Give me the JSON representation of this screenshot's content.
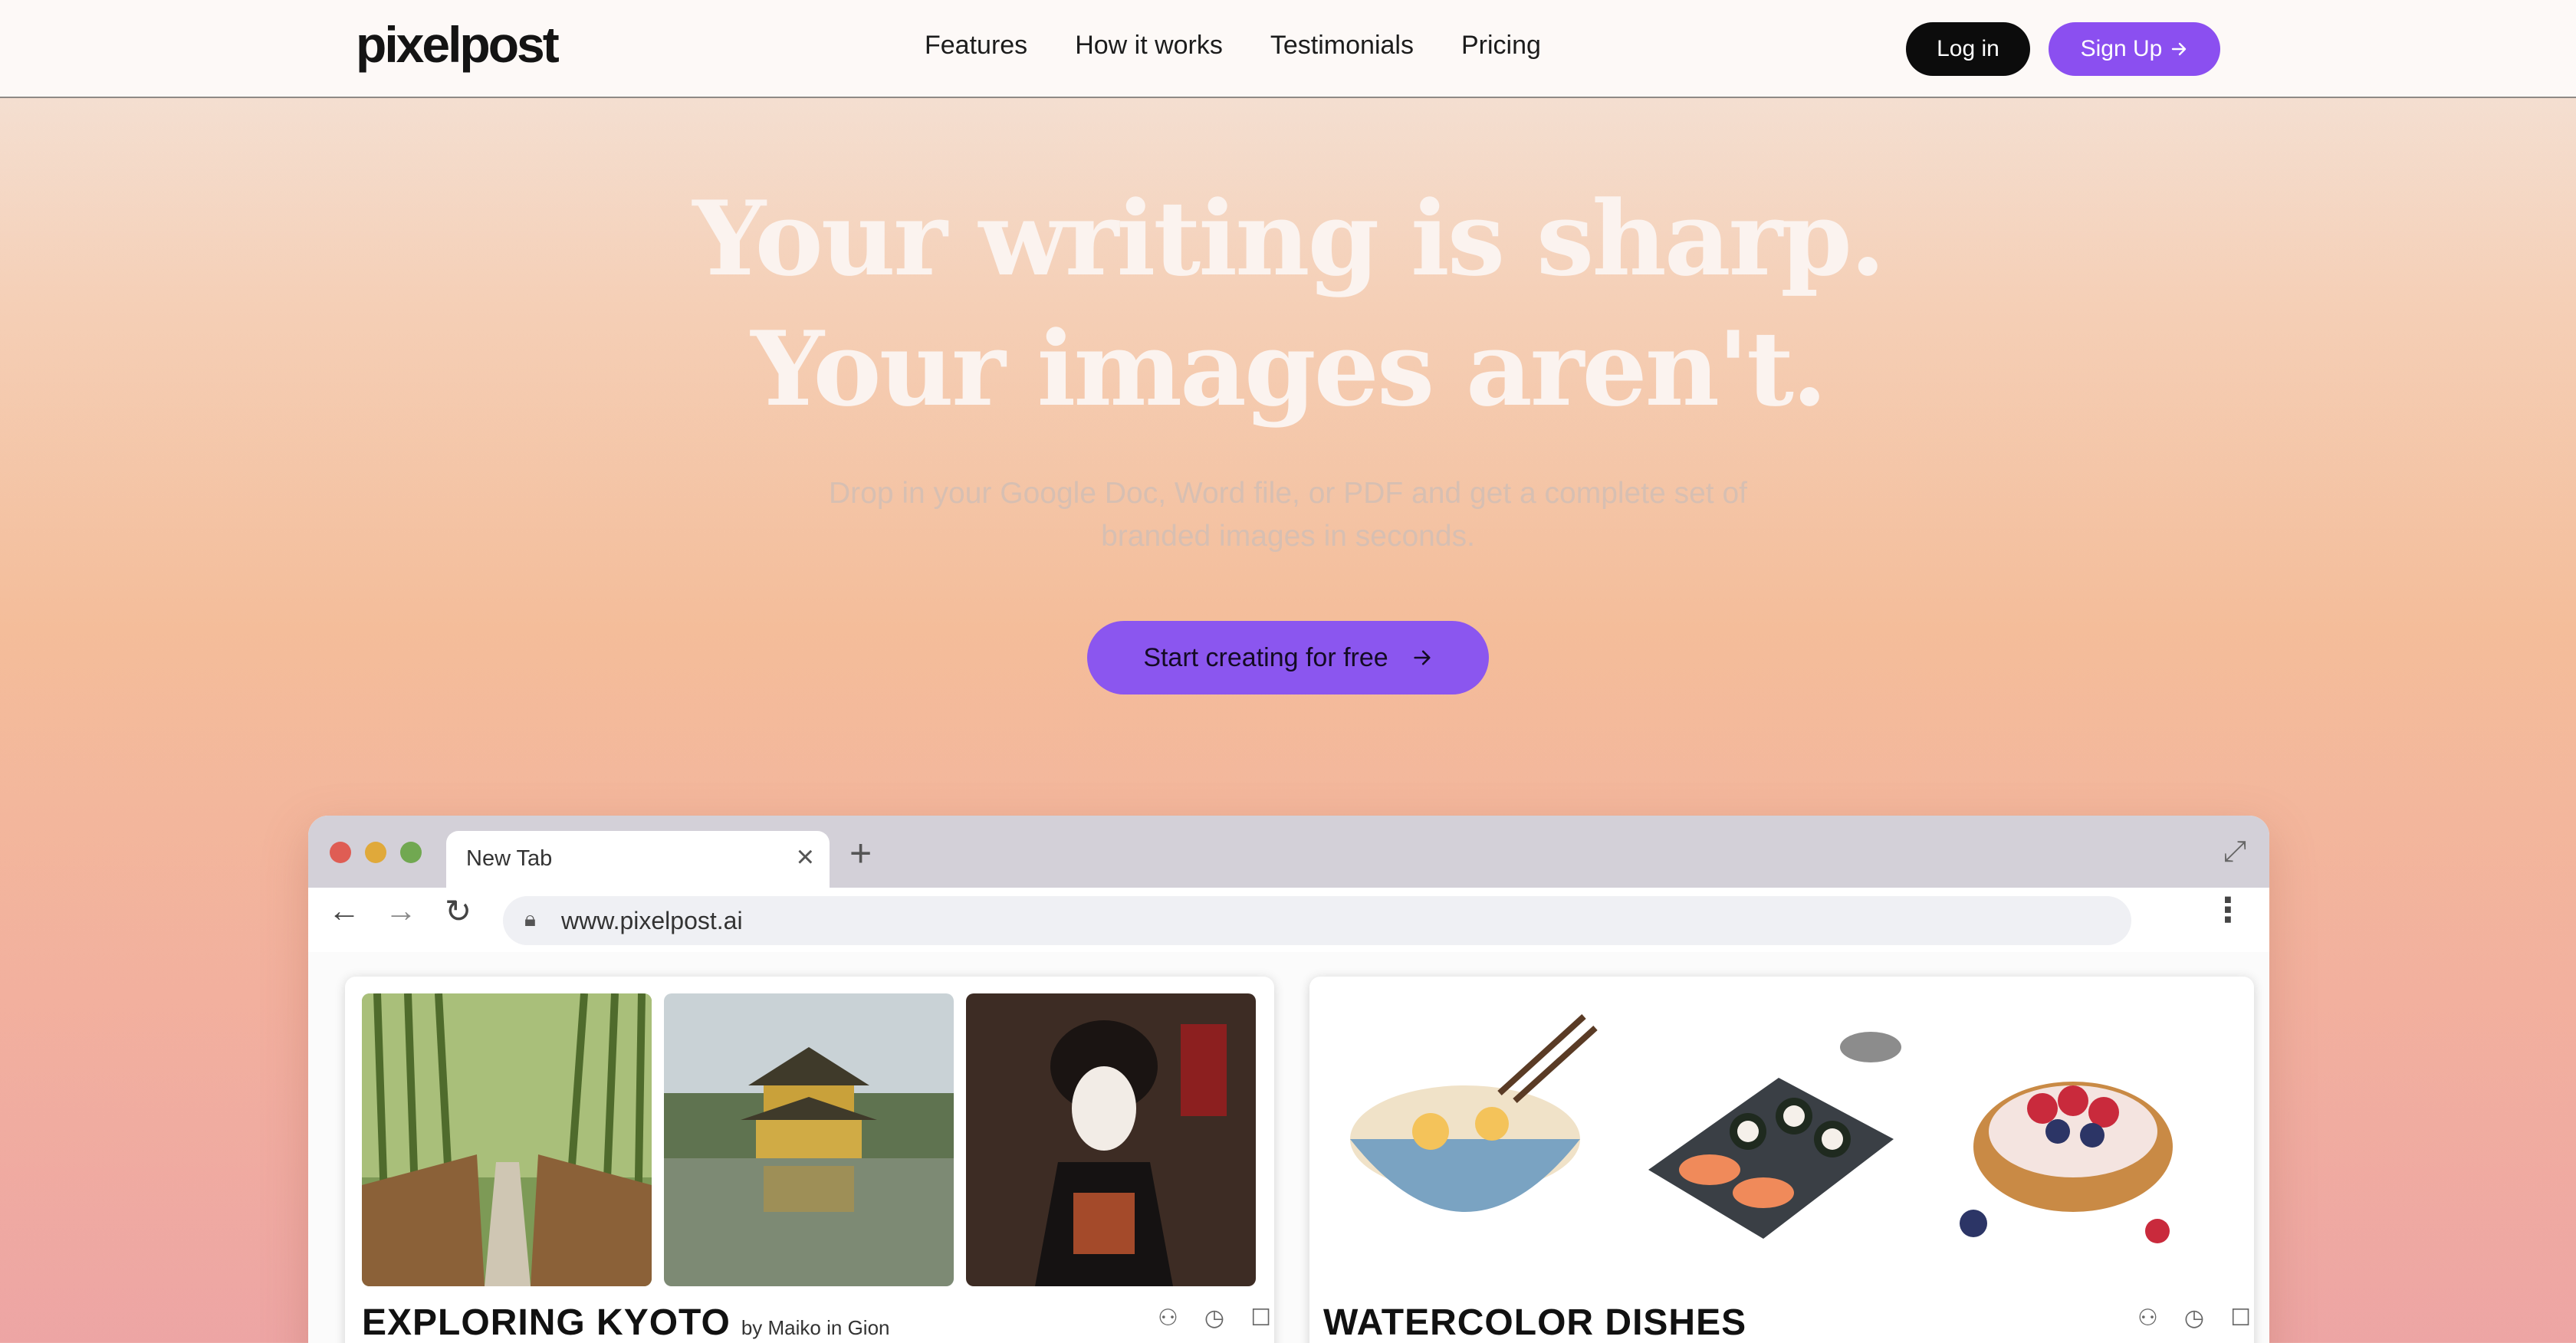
{
  "nav": {
    "logo": "pixelpost",
    "links": [
      "Features",
      "How it works",
      "Testimonials",
      "Pricing"
    ],
    "login_label": "Log in",
    "signup_label": "Sign Up",
    "signup_icon": "arrow-right-icon"
  },
  "hero": {
    "title_line1": "Your writing is sharp.",
    "title_line2": "Your images aren't.",
    "subtitle_line1": "Drop in your Google Doc, Word file, or PDF and get a complete set of",
    "subtitle_line2": "branded images in seconds.",
    "cta_label": "Start creating for free"
  },
  "browser": {
    "tab_label": "New Tab",
    "url": "www.pixelpost.ai",
    "cards": [
      {
        "title": "EXPLORING KYOTO",
        "author": "by Maiko in Gion",
        "thumbnails": [
          "bamboo-forest-image",
          "golden-pavilion-image",
          "geisha-portrait-image"
        ]
      },
      {
        "title": "WATERCOLOR DISHES",
        "author": "",
        "thumbnails": [
          "ramen-bowl-image",
          "sushi-platter-image",
          "berry-tart-image"
        ]
      }
    ]
  },
  "colors": {
    "accent": "#8b4ff0",
    "cta": "#8b56ef",
    "login_bg": "#0c0c0c",
    "traffic_red": "#df5d54",
    "traffic_yellow": "#e0a93a",
    "traffic_green": "#71a851"
  }
}
